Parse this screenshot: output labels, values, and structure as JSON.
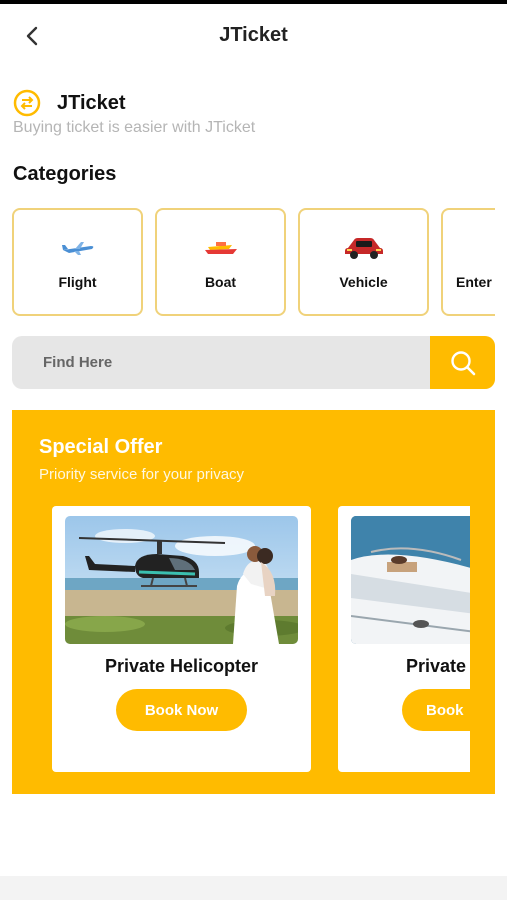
{
  "header": {
    "title": "JTicket",
    "back_icon": "chevron-left-icon"
  },
  "brand": {
    "icon": "ticket-swap-icon",
    "name": "JTicket",
    "tagline": "Buying ticket is easier with JTicket",
    "accent_color": "#ffbb00"
  },
  "categories": {
    "title": "Categories",
    "items": [
      {
        "label": "Flight",
        "icon": "airplane-icon"
      },
      {
        "label": "Boat",
        "icon": "boat-icon"
      },
      {
        "label": "Vehicle",
        "icon": "car-icon"
      },
      {
        "label": "Enter",
        "icon": "entertainment-icon"
      }
    ]
  },
  "search": {
    "placeholder": "Find Here",
    "icon": "search-icon"
  },
  "special_offer": {
    "title": "Special Offer",
    "subtitle": "Priority service for your privacy",
    "items": [
      {
        "name": "Private Helicopter",
        "button": "Book Now",
        "image": "helicopter-couple-photo"
      },
      {
        "name": "Private",
        "button": "Book",
        "image": "yacht-photo"
      }
    ]
  }
}
